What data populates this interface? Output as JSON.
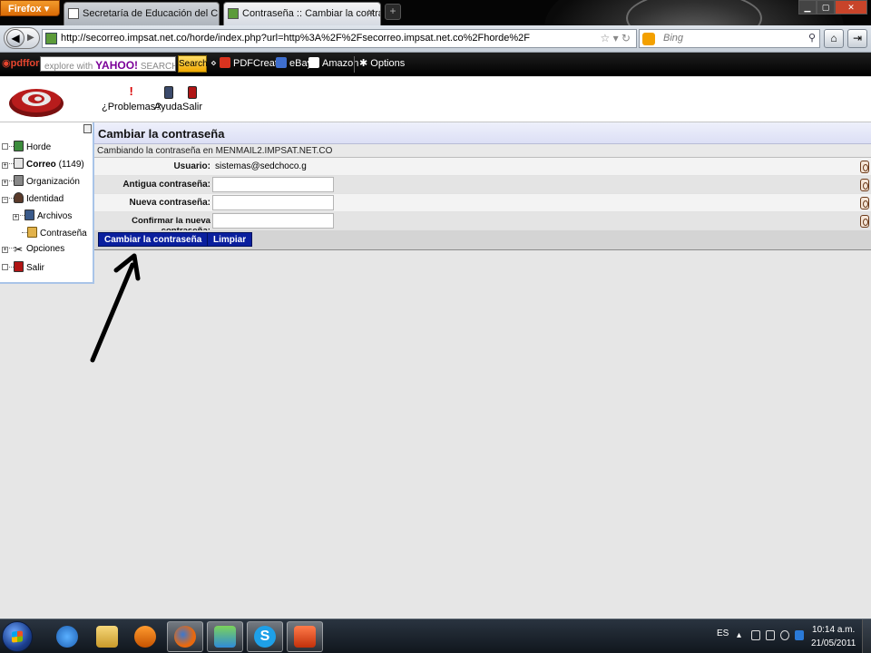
{
  "browser": {
    "menu_button": "Firefox",
    "tabs": [
      {
        "label": "Secretaría de Educación del Chocó"
      },
      {
        "label": "Contraseña :: Cambiar la contraseña"
      }
    ],
    "new_tab": "+",
    "url": "http://secorreo.impsat.net.co/horde/index.php?url=http%3A%2F%2Fsecorreo.impsat.net.co%2Fhorde%2F",
    "search_engine": "Bing",
    "toolbar": {
      "pdfforge": "pdfforge",
      "yahoo_placeholder": "explore with",
      "yahoo_brand": "YAHOO!",
      "yahoo_search": "SEARCH",
      "search_button": "Search",
      "pdfcreator": "PDFCreator",
      "ebay": "eBay",
      "amazon": "Amazon",
      "options": "Options"
    }
  },
  "horde": {
    "header_links": [
      {
        "label": "¿Problemas?",
        "icon": "exclamation-icon"
      },
      {
        "label": "Ayuda",
        "icon": "book-icon"
      },
      {
        "label": "Salir",
        "icon": "logout-icon"
      }
    ],
    "sidebar": {
      "items": [
        {
          "label": "Horde",
          "icon": "horde-icon"
        },
        {
          "label": "Correo",
          "count": "(1149)",
          "icon": "mail-icon"
        },
        {
          "label": "Organización",
          "icon": "organizer-icon"
        },
        {
          "label": "Identidad",
          "icon": "user-icon"
        },
        {
          "label": "Archivos",
          "icon": "files-icon"
        },
        {
          "label": "Contraseña",
          "icon": "lock-icon"
        },
        {
          "label": "Opciones",
          "icon": "tools-icon"
        },
        {
          "label": "Salir",
          "icon": "logout-icon"
        }
      ]
    },
    "title": "Cambiar la contraseña",
    "subtitle": "Cambiando la contraseña en MENMAIL2.IMPSAT.NET.CO",
    "form": {
      "usuario_label": "Usuario:",
      "usuario_value": "sistemas@sedchoco.g",
      "old_label": "Antigua contraseña:",
      "old_value": "",
      "new_label": "Nueva contraseña:",
      "new_value": "",
      "confirm_label": "Confirmar la nueva contraseña:",
      "confirm_value": ""
    },
    "buttons": {
      "change": "Cambiar la contraseña",
      "reset": "Limpiar"
    }
  },
  "taskbar": {
    "apps": [
      "internet-explorer",
      "explorer",
      "media-player",
      "firefox",
      "messenger",
      "skype",
      "powerpoint"
    ],
    "language": "ES",
    "time": "10:14 a.m.",
    "date": "21/05/2011"
  }
}
